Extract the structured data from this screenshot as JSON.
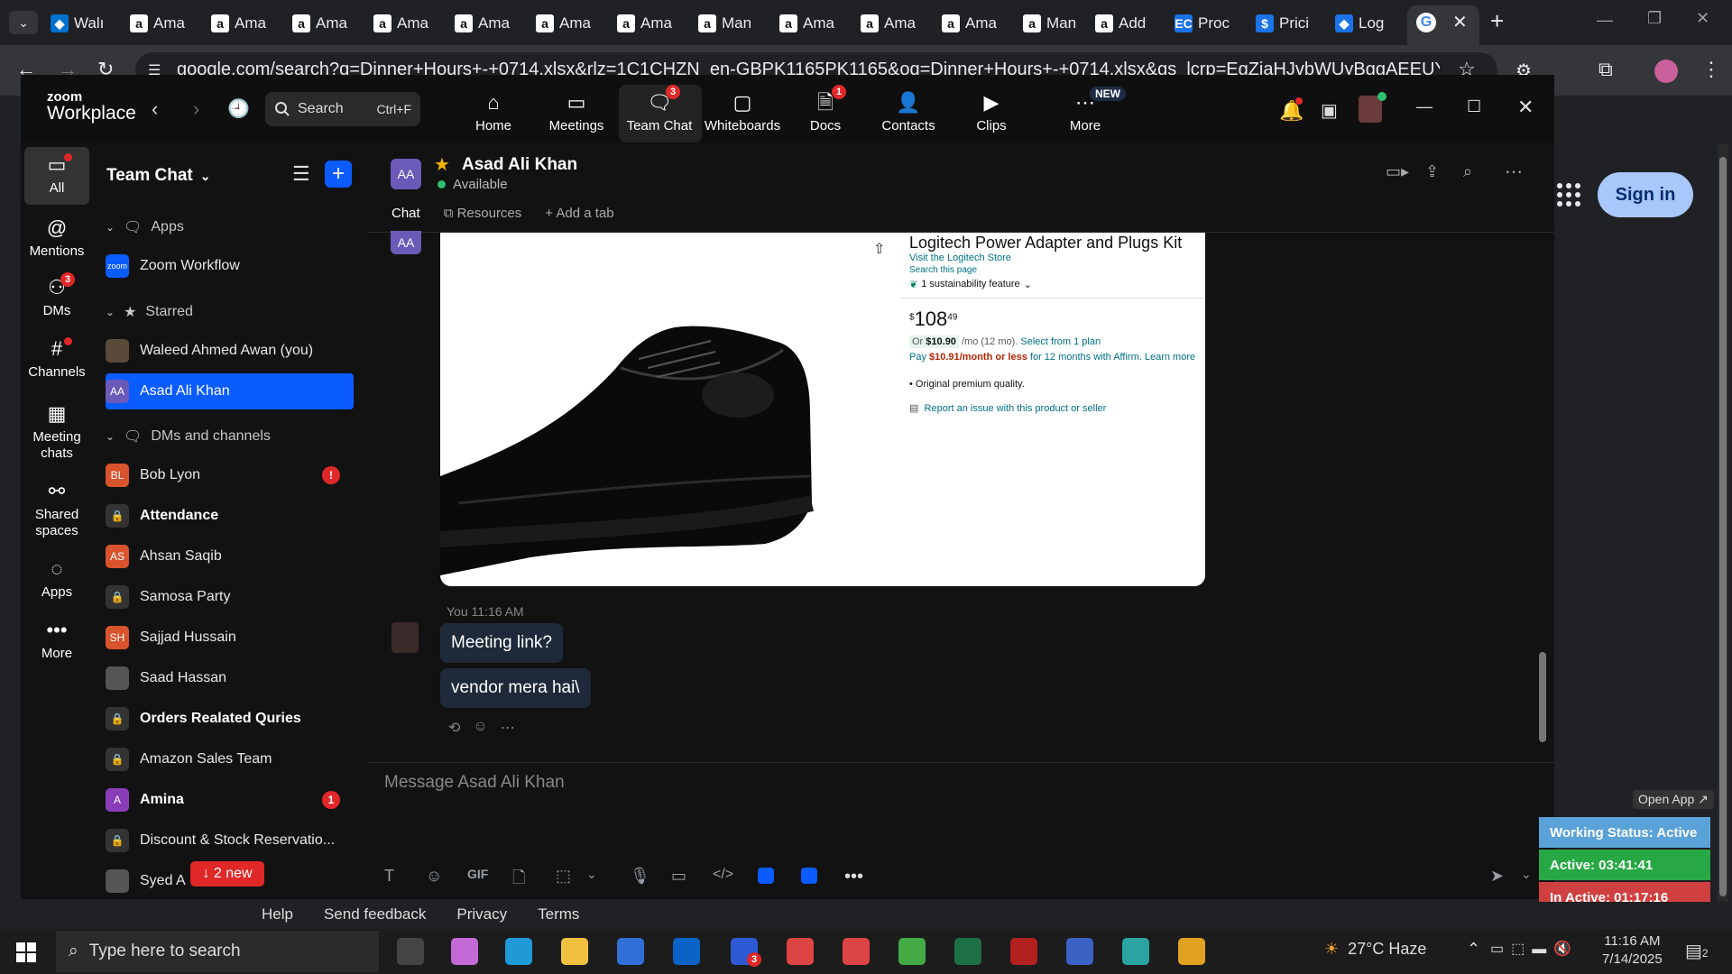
{
  "browser": {
    "tabs": [
      {
        "label": "Walı",
        "icon": "walmart-icon",
        "color": "#0071ce"
      },
      {
        "label": "Ama",
        "icon": "amazon-icon"
      },
      {
        "label": "Ama",
        "icon": "amazon-icon"
      },
      {
        "label": "Ama",
        "icon": "amazon-icon"
      },
      {
        "label": "Ama",
        "icon": "amazon-icon"
      },
      {
        "label": "Ama",
        "icon": "amazon-icon"
      },
      {
        "label": "Ama",
        "icon": "amazon-icon"
      },
      {
        "label": "Ama",
        "icon": "amazon-icon"
      },
      {
        "label": "Man",
        "icon": "amazon-icon"
      },
      {
        "label": "Ama",
        "icon": "amazon-icon"
      },
      {
        "label": "Ama",
        "icon": "amazon-icon"
      },
      {
        "label": "Ama",
        "icon": "amazon-icon"
      },
      {
        "label": "Man",
        "icon": "amazon-icon"
      },
      {
        "label": "Add",
        "icon": "amazon-icon"
      },
      {
        "label": "Proc",
        "icon": "ec-icon",
        "color": "#1a73e8"
      },
      {
        "label": "Prici",
        "icon": "dollar-icon",
        "color": "#1a73e8"
      },
      {
        "label": "Log",
        "icon": "sheets-icon",
        "color": "#1a73e8"
      }
    ],
    "url": "google.com/search?q=Dinner+Hours+-+0714.xlsx&rlz=1C1CHZN_en-GBPK1165PK1165&oq=Dinner+Hours+-+0714.xlsx&gs_lcrp=EgZjaHJvbWUyBggAEEUYOTIHCAEQIRiqATIHCAI",
    "signin_label": "Sign in",
    "new_tab_symbol": "+"
  },
  "zoom": {
    "logo_top": "zoom",
    "logo_bottom": "Workplace",
    "search_label": "Search",
    "search_shortcut": "Ctrl+F",
    "nav": [
      {
        "label": "Home",
        "icon": "home-icon",
        "badge": ""
      },
      {
        "label": "Meetings",
        "icon": "video-camera-icon",
        "badge": ""
      },
      {
        "label": "Team Chat",
        "icon": "chat-icon",
        "badge": "3"
      },
      {
        "label": "Whiteboards",
        "icon": "whiteboard-icon",
        "badge": ""
      },
      {
        "label": "Docs",
        "icon": "docs-icon",
        "badge": "1"
      },
      {
        "label": "Contacts",
        "icon": "contacts-icon",
        "badge": ""
      },
      {
        "label": "Clips",
        "icon": "clips-icon",
        "badge": ""
      },
      {
        "label": "More",
        "icon": "more-icon",
        "badge": "NEW"
      }
    ],
    "rail": [
      {
        "label": "All",
        "icon": "chat-bubble-icon",
        "badge": "dot"
      },
      {
        "label": "Mentions",
        "icon": "at-icon",
        "badge": ""
      },
      {
        "label": "DMs",
        "icon": "people-icon",
        "badge": "3"
      },
      {
        "label": "Channels",
        "icon": "hash-icon",
        "badge": "dot"
      },
      {
        "label": "Meeting chats",
        "icon": "calendar-icon",
        "badge": ""
      },
      {
        "label": "Shared spaces",
        "icon": "shared-icon",
        "badge": ""
      },
      {
        "label": "Apps",
        "icon": "apps-bubble-icon",
        "badge": ""
      },
      {
        "label": "More",
        "icon": "ellipsis-icon",
        "badge": ""
      }
    ],
    "sidebar": {
      "title": "Team Chat",
      "sections": {
        "apps": "Apps",
        "starred": "Starred",
        "dms": "DMs and channels"
      },
      "apps": [
        {
          "name": "Zoom Workflow",
          "avatar": "zoom"
        }
      ],
      "starred": [
        {
          "name": "Waleed Ahmed Awan (you)",
          "avatar": "",
          "color": "#5a4a3a"
        },
        {
          "name": "Asad Ali Khan",
          "avatar": "AA",
          "color": "#6b5ab8"
        }
      ],
      "dms": [
        {
          "name": "Bob Lyon",
          "avatar": "BL",
          "color": "#d9532c",
          "bold": false,
          "badge": "!"
        },
        {
          "name": "Attendance",
          "avatar": "lock",
          "color": "",
          "bold": true,
          "badge": ""
        },
        {
          "name": "Ahsan Saqib",
          "avatar": "AS",
          "color": "#d9532c",
          "bold": false,
          "badge": ""
        },
        {
          "name": "Samosa Party",
          "avatar": "lock",
          "color": "",
          "bold": false,
          "badge": ""
        },
        {
          "name": "Sajjad Hussain",
          "avatar": "SH",
          "color": "#d9532c",
          "bold": false,
          "badge": ""
        },
        {
          "name": "Saad Hassan",
          "avatar": "",
          "color": "#555",
          "bold": false,
          "badge": ""
        },
        {
          "name": "Orders Realated Quries",
          "avatar": "lock",
          "color": "",
          "bold": true,
          "badge": ""
        },
        {
          "name": "Amazon Sales Team",
          "avatar": "lock",
          "color": "",
          "bold": false,
          "badge": ""
        },
        {
          "name": "Amina",
          "avatar": "A",
          "color": "#8a3db8",
          "bold": true,
          "badge": "1"
        },
        {
          "name": "Discount & Stock Reservatio...",
          "avatar": "lock",
          "color": "",
          "bold": false,
          "badge": ""
        },
        {
          "name": "Syed A",
          "avatar": "",
          "color": "#555",
          "bold": false,
          "badge": ""
        }
      ],
      "new_pill": "↓ 2 new"
    },
    "chat": {
      "contact_name": "Asad Ali Khan",
      "contact_initials": "AA",
      "status": "Available",
      "tabs": [
        "Chat",
        "Resources",
        "Add a tab"
      ],
      "product": {
        "title": "Logitech Power Adapter and Plugs Kit",
        "store": "Visit the Logitech Store",
        "search_page": "Search this page",
        "sustainability": "1 sustainability feature",
        "price_sup": "$",
        "price_whole": "108",
        "price_frac": "49",
        "installment_prefix": "Or ",
        "installment_amount": "$10.90",
        "installment_suffix": " /mo (12 mo). ",
        "installment_link": "Select from 1 plan",
        "affirm_prefix": "Pay ",
        "affirm_amount": "$10.91/month or less",
        "affirm_suffix": " for 12 months with Affirm. Learn more",
        "bullet": "Original premium quality.",
        "report": "Report an issue with this product or seller"
      },
      "sender_line": "You 11:16 AM",
      "messages": [
        "Meeting link?",
        "vendor mera hai\\"
      ],
      "composer_placeholder": "Message Asad Ali Khan",
      "gif_label": "GIF"
    },
    "footer_links": [
      "Help",
      "Send feedback",
      "Privacy",
      "Terms"
    ]
  },
  "status_widget": {
    "open_app": "Open App ↗",
    "working": "Working Status: Active",
    "active": "Active: 03:41:41",
    "inactive": "In Active: 01:17:16"
  },
  "taskbar": {
    "search_placeholder": "Type here to search",
    "weather": "27°C  Haze",
    "time": "11:16 AM",
    "date": "7/14/2025",
    "notif_count": "2",
    "zoom_badge": "3"
  }
}
